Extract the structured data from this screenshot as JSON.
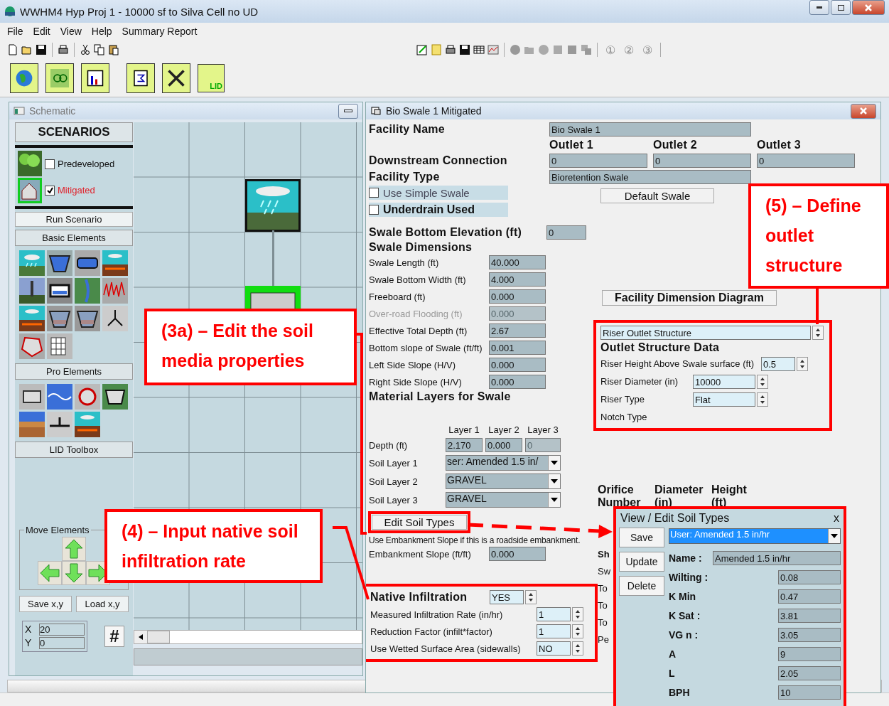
{
  "window": {
    "title": "WWHM4   Hyp Proj 1 - 10000 sf to Silva Cell no UD"
  },
  "menu": [
    "File",
    "Edit",
    "View",
    "Help",
    "Summary Report"
  ],
  "toolbar": {
    "digits": [
      "①",
      "②",
      "③"
    ]
  },
  "big_toolbar": {
    "lid_label": "LID"
  },
  "schematic": {
    "title": "Schematic",
    "scenarios_heading": "SCENARIOS",
    "scenarios": [
      {
        "label": "Predeveloped",
        "checked": false
      },
      {
        "label": "Mitigated",
        "checked": true
      }
    ],
    "run_button": "Run Scenario",
    "basic_heading": "Basic Elements",
    "pro_heading": "Pro Elements",
    "lid_heading": "LID Toolbox",
    "move_group": {
      "title": "Move Elements",
      "buttons": [
        "Save x,y",
        "Load x,y"
      ]
    },
    "coords": [
      {
        "label": "X",
        "value": "20"
      },
      {
        "label": "Y",
        "value": "0"
      }
    ],
    "grid_button": "#"
  },
  "swale": {
    "title": "Bio Swale 1 Mitigated",
    "facility_name": {
      "label": "Facility Name",
      "value": "Bio Swale  1"
    },
    "outlets": [
      "Outlet 1",
      "Outlet 2",
      "Outlet 3"
    ],
    "downstream": {
      "label": "Downstream Connection",
      "values": [
        "0",
        "0",
        "0"
      ]
    },
    "facility_type": {
      "label": "Facility Type",
      "value": "Bioretention Swale"
    },
    "options": [
      {
        "label": "Use Simple Swale",
        "checked": false,
        "bold": false
      },
      {
        "label": "Underdrain Used",
        "checked": false,
        "bold": true
      }
    ],
    "default_button": "Default Swale",
    "bottom_elevation": {
      "label": "Swale Bottom Elevation (ft)",
      "value": "0"
    },
    "dimensions": {
      "heading": "Swale Dimensions",
      "rows": [
        {
          "label": "Swale Length (ft)",
          "value": "40.000",
          "disabled": false
        },
        {
          "label": "Swale Bottom Width (ft)",
          "value": "4.000",
          "disabled": false
        },
        {
          "label": "Freeboard (ft)",
          "value": "0.000",
          "disabled": false
        },
        {
          "label": "Over-road Flooding (ft)",
          "value": "0.000",
          "disabled": true
        },
        {
          "label": "Effective Total Depth (ft)",
          "value": "2.67",
          "disabled": false
        },
        {
          "label": "Bottom slope of Swale (ft/ft)",
          "value": "0.001",
          "disabled": false
        },
        {
          "label": "Left Side Slope (H/V)",
          "value": "0.000",
          "disabled": false
        },
        {
          "label": "Right Side Slope (H/V)",
          "value": "0.000",
          "disabled": false
        }
      ]
    },
    "dimension_diagram_button": "Facility Dimension Diagram",
    "layers": {
      "heading": "Material Layers for Swale",
      "columns": [
        "Layer 1",
        "Layer 2",
        "Layer 3"
      ],
      "depth": {
        "label": "Depth (ft)",
        "values": [
          {
            "value": "2.170",
            "disabled": false
          },
          {
            "value": "0.000",
            "disabled": false
          },
          {
            "value": "0",
            "disabled": true
          }
        ]
      },
      "soils": [
        {
          "label": "Soil Layer 1",
          "value": "ser: Amended 1.5 in/"
        },
        {
          "label": "Soil Layer 2",
          "value": "GRAVEL"
        },
        {
          "label": "Soil Layer 3",
          "value": "GRAVEL"
        }
      ]
    },
    "edit_soil_button": "Edit Soil Types",
    "embankment_note": "Use Embankment Slope if this is a roadside embankment.",
    "embankment": {
      "label": "Embankment Slope (ft/ft)",
      "value": "0.000"
    },
    "native": {
      "heading": "Native Infiltration",
      "value": "YES",
      "rows": [
        {
          "label": "Measured Infiltration Rate (in/hr)",
          "value": "1"
        },
        {
          "label": "Reduction Factor (infilt*factor)",
          "value": "1"
        },
        {
          "label": "Use Wetted Surface Area (sidewalls)",
          "value": "NO"
        }
      ]
    },
    "outlet_structure": {
      "type": "Riser Outlet Structure",
      "heading": "Outlet Structure Data",
      "rows": [
        {
          "label": "Riser Height Above Swale surface (ft)",
          "value": "0.5"
        },
        {
          "label": "Riser Diameter (in)",
          "value": "10000"
        },
        {
          "label": "Riser Type",
          "value": "Flat"
        },
        {
          "label": "Notch Type"
        }
      ]
    },
    "orifice_header": [
      {
        "top": "Orifice",
        "bottom": "Number"
      },
      {
        "top": "Diameter",
        "bottom": "(in)"
      },
      {
        "top": "Height",
        "bottom": "(ft)"
      }
    ],
    "covered_labels": [
      {
        "text": "Sh",
        "bold": true
      },
      {
        "text": "Sw",
        "bold": false
      },
      {
        "text": "To",
        "bold": false
      },
      {
        "text": "To",
        "bold": false
      },
      {
        "text": "To",
        "bold": false
      },
      {
        "text": "Pe",
        "bold": false
      }
    ]
  },
  "soil_dialog": {
    "title": "View / Edit Soil Types",
    "close": "x",
    "buttons": [
      "Save",
      "Update",
      "Delete"
    ],
    "selected_soil": "User: Amended 1.5 in/hr",
    "fields": [
      {
        "label": "Name :",
        "value": "Amended 1.5 in/hr",
        "kind": "wide"
      },
      {
        "label": "Wilting :",
        "value": "0.08",
        "kind": "narrow"
      },
      {
        "label": "K Min",
        "value": "0.47",
        "kind": "narrow"
      },
      {
        "label": "K Sat :",
        "value": "3.81",
        "kind": "narrow"
      },
      {
        "label": "VG n :",
        "value": "3.05",
        "kind": "narrow"
      },
      {
        "label": "A",
        "value": "9",
        "kind": "narrow"
      },
      {
        "label": "L",
        "value": "2.05",
        "kind": "narrow"
      },
      {
        "label": "BPH",
        "value": "10",
        "kind": "narrow"
      }
    ]
  },
  "annotations": [
    {
      "text": "(3a) – Edit the soil media properties"
    },
    {
      "text": "(5) – Define outlet structure"
    },
    {
      "text": "(4) – Input native soil infiltration rate"
    }
  ]
}
